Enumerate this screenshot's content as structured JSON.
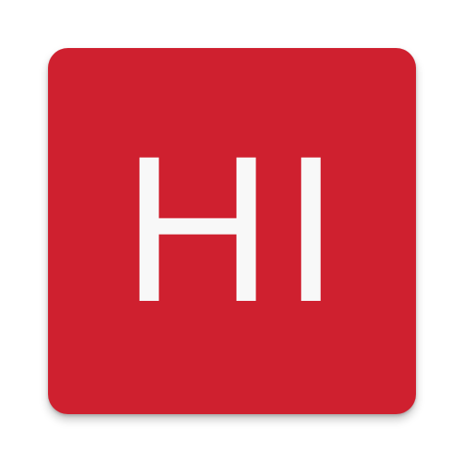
{
  "app_icon": {
    "text": "HI",
    "background_color": "#cf202f",
    "text_color": "#f8f8f8"
  }
}
